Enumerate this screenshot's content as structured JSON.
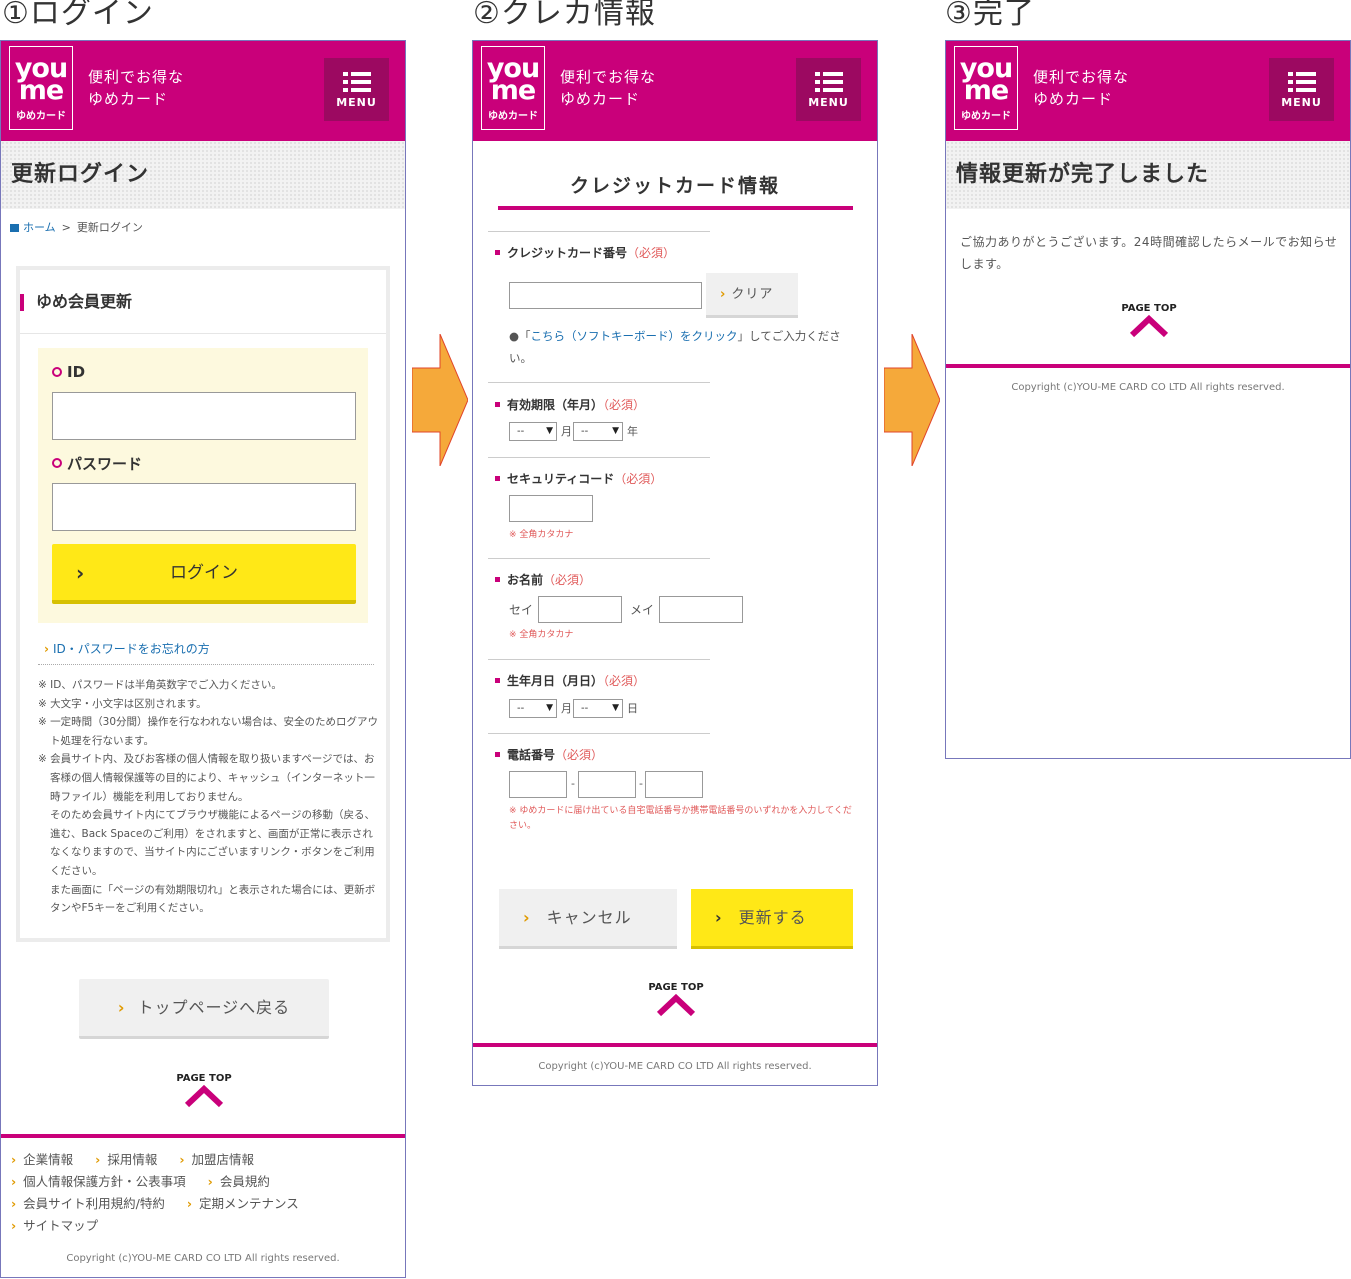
{
  "steps": [
    "①ログイン",
    "②クレカ情報",
    "③完了"
  ],
  "header": {
    "logo_top": "you",
    "logo_mid": "me",
    "logo_sub": "ゆめカード",
    "tagline_1": "便利でお得な",
    "tagline_2": "ゆめカード",
    "menu_label": "MENU"
  },
  "login": {
    "page_title": "更新ログイン",
    "breadcrumb_home": "ホーム",
    "breadcrumb_sep": ">",
    "breadcrumb_current": "更新ログイン",
    "box_title": "ゆめ会員更新",
    "id_label": "ID",
    "password_label": "パスワード",
    "login_button": "ログイン",
    "forgot_link": "ID・パスワードをお忘れの方",
    "notes": [
      "※ ID、パスワードは半角英数字でご入力ください。",
      "※ 大文字・小文字は区別されます。",
      "※ 一定時間（30分間）操作を行なわれない場合は、安全のためログアウト処理を行ないます。",
      "※ 会員サイト内、及びお客様の個人情報を取り扱いますページでは、お客様の個人情報保護等の目的により、キャッシュ（インターネット一時ファイル）機能を利用しておりません。"
    ],
    "notes_continued": [
      "そのため会員サイト内にてブラウザ機能によるページの移動（戻る、進む、Back Spaceのご利用）をされますと、画面が正常に表示されなくなりますので、当サイト内にございますリンク・ボタンをご利用ください。",
      "また画面に「ページの有効期限切れ」と表示された場合には、更新ボタンやF5キーをご利用ください。"
    ],
    "back_to_top_button": "トップページへ戻る",
    "footer_links": [
      [
        "企業情報",
        "採用情報",
        "加盟店情報"
      ],
      [
        "個人情報保護方針・公表事項",
        "会員規約"
      ],
      [
        "会員サイト利用規約/特約",
        "定期メンテナンス"
      ],
      [
        "サイトマップ"
      ]
    ]
  },
  "credit": {
    "title": "クレジットカード情報",
    "required": "（必須）",
    "card_number_label": "クレジットカード番号",
    "clear_button": "クリア",
    "keyboard_note_bullet": "●",
    "keyboard_note_open": "「",
    "keyboard_note_link": "こちら（ソフトキーボード）をクリック",
    "keyboard_note_close": "」してご入力ください。",
    "expiry_label": "有効期限（年月）",
    "month_select": "--",
    "month_unit": "月",
    "year_select": "--",
    "year_unit": "年",
    "security_label": "セキュリティコード",
    "katakana_note": "※ 全角カタカナ",
    "name_label": "お名前",
    "sei": "セイ",
    "mei": "メイ",
    "birthday_label": "生年月日（月日）",
    "bmonth_select": "--",
    "bmonth_unit": "月",
    "bday_select": "--",
    "bday_unit": "日",
    "phone_label": "電話番号",
    "phone_sep": "-",
    "phone_note": "※ ゆめカードに届け出ている自宅電話番号か携帯電話番号のいずれかを入力してください。",
    "cancel_button": "キャンセル",
    "update_button": "更新する"
  },
  "complete": {
    "page_title": "情報更新が完了しました",
    "message": "ご協力ありがとうございます。24時間確認したらメールでお知らせします。"
  },
  "common": {
    "page_top": "PAGE TOP",
    "copyright": "Copyright (c)YOU-ME CARD CO LTD All rights reserved."
  },
  "colors": {
    "brand": "#c9007a",
    "button_yellow": "#ffe817",
    "arrow_orange": "#f5a93a"
  }
}
